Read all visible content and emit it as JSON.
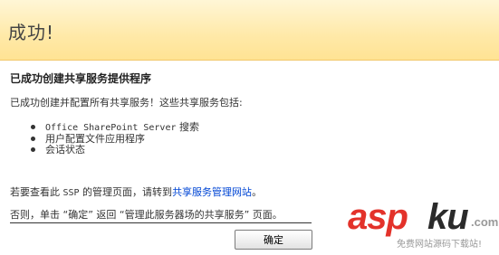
{
  "header": {
    "title": "成功!"
  },
  "main": {
    "heading": "已成功创建共享服务提供程序",
    "intro": "已成功创建并配置所有共享服务！这些共享服务包括:",
    "services": [
      {
        "mono": "Office SharePoint Server",
        "text": " 搜索"
      },
      {
        "mono": "",
        "text": "用户配置文件应用程序"
      },
      {
        "mono": "",
        "text": "会话状态"
      }
    ],
    "manage_prefix": "若要查看此 ",
    "manage_ssp": "SSP",
    "manage_middle": " 的管理页面，请转到",
    "manage_link": "共享服务管理网站",
    "manage_suffix": "。",
    "otherwise": "否则，单击 “确定” 返回 “管理此服务器场的共享服务” 页面。",
    "ok_label": "确定"
  },
  "watermark": {
    "asp": "asp",
    "ku": "ku",
    "com": ".com",
    "tagline": "免费网站源码下载站!"
  }
}
